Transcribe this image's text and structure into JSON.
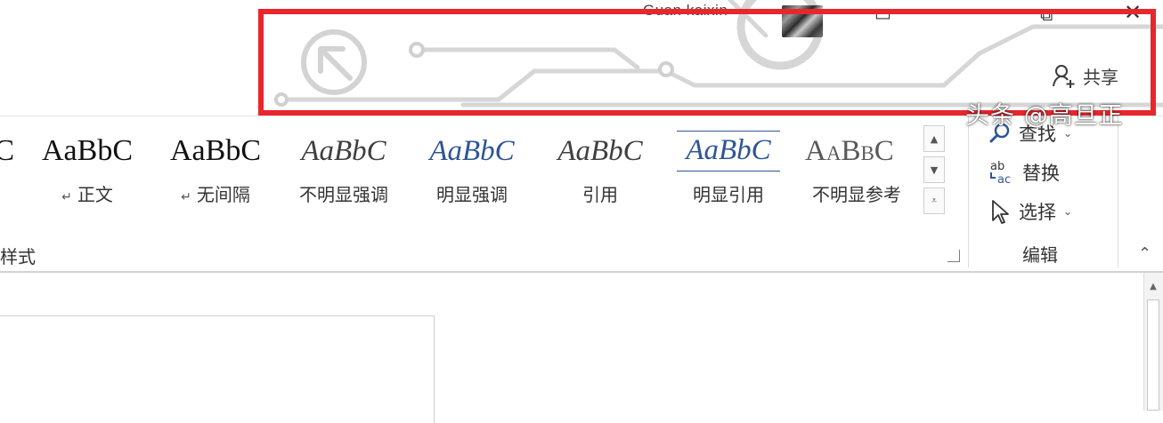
{
  "titlebar": {
    "user_name": "Guan kaixin",
    "share_label": "共享"
  },
  "styles": {
    "items": [
      {
        "preview": "C",
        "name": "",
        "has_para_mark": false
      },
      {
        "preview": "AaBbC",
        "name": "正文",
        "has_para_mark": true
      },
      {
        "preview": "AaBbC",
        "name": "无间隔",
        "has_para_mark": true
      },
      {
        "preview": "AaBbC",
        "name": "不明显强调",
        "has_para_mark": false
      },
      {
        "preview": "AaBbC",
        "name": "明显强调",
        "has_para_mark": false
      },
      {
        "preview": "AaBbC",
        "name": "引用",
        "has_para_mark": false
      },
      {
        "preview": "AaBbC",
        "name": "明显引用",
        "has_para_mark": false
      },
      {
        "preview": "AaBbC",
        "name": "不明显参考",
        "has_para_mark": false
      }
    ],
    "group_label": "样式"
  },
  "editing": {
    "find_label": "查找",
    "replace_label": "替换",
    "select_label": "选择",
    "group_label": "编辑"
  },
  "watermark": "头条 @高旦正",
  "colors": {
    "highlight_border": "#e8262c",
    "accent_blue": "#2f5597"
  }
}
